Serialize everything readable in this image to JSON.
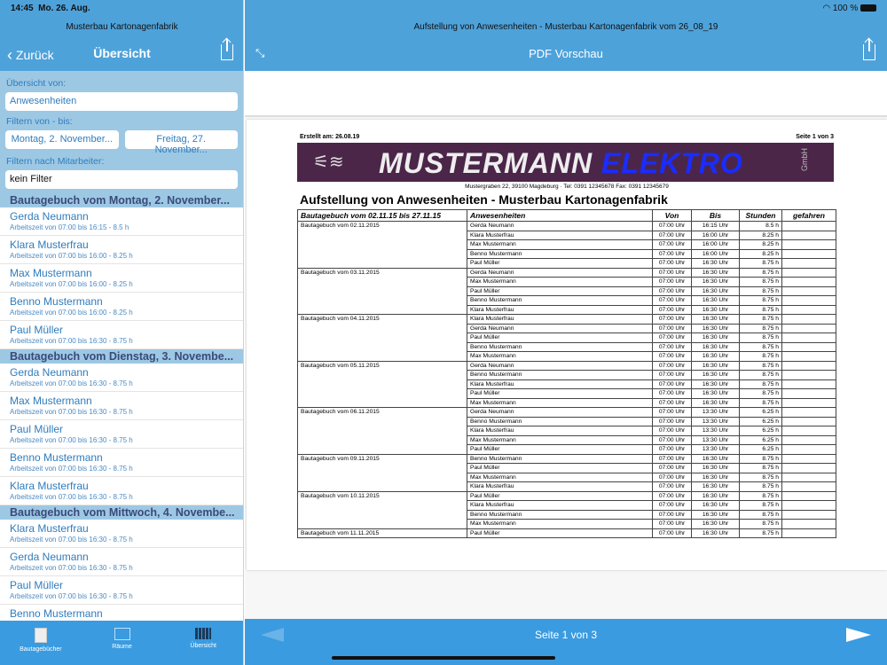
{
  "status": {
    "time": "14:45",
    "date": "Mo. 26. Aug.",
    "battery": "100 %"
  },
  "left": {
    "app_title": "Musterbau Kartonagenfabrik",
    "back": "Zurück",
    "title": "Übersicht",
    "overview_label": "Übersicht von:",
    "overview_value": "Anwesenheiten",
    "range_label": "Filtern von - bis:",
    "from": "Montag, 2. November...",
    "to": "Freitag, 27. November...",
    "employee_label": "Filtern nach Mitarbeiter:",
    "employee_value": "kein Filter",
    "sections": [
      {
        "title": "Bautagebuch vom Montag, 2. November...",
        "items": [
          {
            "name": "Gerda Neumann",
            "sub": "Arbeitszeit von 07:00 bis 16:15 - 8.5 h"
          },
          {
            "name": "Klara Musterfrau",
            "sub": "Arbeitszeit von 07:00 bis 16:00 - 8.25 h"
          },
          {
            "name": "Max Mustermann",
            "sub": "Arbeitszeit von 07:00 bis 16:00 - 8.25 h"
          },
          {
            "name": "Benno Mustermann",
            "sub": "Arbeitszeit von 07:00 bis 16:00 - 8.25 h"
          },
          {
            "name": "Paul Müller",
            "sub": "Arbeitszeit von 07:00 bis 16:30 - 8.75 h"
          }
        ]
      },
      {
        "title": "Bautagebuch vom Dienstag, 3. Novembe...",
        "items": [
          {
            "name": "Gerda Neumann",
            "sub": "Arbeitszeit von 07:00 bis 16:30 - 8.75 h"
          },
          {
            "name": "Max Mustermann",
            "sub": "Arbeitszeit von 07:00 bis 16:30 - 8.75 h"
          },
          {
            "name": "Paul Müller",
            "sub": "Arbeitszeit von 07:00 bis 16:30 - 8.75 h"
          },
          {
            "name": "Benno Mustermann",
            "sub": "Arbeitszeit von 07:00 bis 16:30 - 8.75 h"
          },
          {
            "name": "Klara Musterfrau",
            "sub": "Arbeitszeit von 07:00 bis 16:30 - 8.75 h"
          }
        ]
      },
      {
        "title": "Bautagebuch vom Mittwoch, 4. Novembe...",
        "items": [
          {
            "name": "Klara Musterfrau",
            "sub": "Arbeitszeit von 07:00 bis 16:30 - 8.75 h"
          },
          {
            "name": "Gerda Neumann",
            "sub": "Arbeitszeit von 07:00 bis 16:30 - 8.75 h"
          },
          {
            "name": "Paul Müller",
            "sub": "Arbeitszeit von 07:00 bis 16:30 - 8.75 h"
          },
          {
            "name": "Benno Mustermann",
            "sub": ""
          }
        ]
      }
    ],
    "tabs": [
      "Bautagebücher",
      "Räume",
      "Übersicht"
    ]
  },
  "right": {
    "doc_title": "Aufstellung von Anwesenheiten - Musterbau Kartonagenfabrik vom 26_08_19",
    "nav_title": "PDF Vorschau",
    "page_indicator": "Seite 1 von 3"
  },
  "pdf": {
    "created": "Erstellt am: 26.08.19",
    "page": "Seite 1 von  3",
    "logo_text_1": "MUSTERMANN",
    "logo_text_2": "ELEKTRO",
    "logo_gmbh": "GmbH",
    "address": "Mustergraben 22, 39100 Magdeburg  ·  Tel: 0391 12345678 Fax: 0391 12345679",
    "title": "Aufstellung von Anwesenheiten - Musterbau Kartonagenfabrik",
    "headers": [
      "Bautagebuch vom 02.11.15 bis 27.11.15",
      "Anwesenheiten",
      "Von",
      "Bis",
      "Stunden",
      "gefahren"
    ],
    "groups": [
      {
        "date": "Bautagebuch vom 02.11.2015",
        "rows": [
          [
            "Gerda Neumann",
            "07:00 Uhr",
            "16:15 Uhr",
            "8.5 h"
          ],
          [
            "Klara Musterfrau",
            "07:00 Uhr",
            "16:00 Uhr",
            "8.25 h"
          ],
          [
            "Max Mustermann",
            "07:00 Uhr",
            "16:00 Uhr",
            "8.25 h"
          ],
          [
            "Benno Mustermann",
            "07:00 Uhr",
            "16:00 Uhr",
            "8.25 h"
          ],
          [
            "Paul Müller",
            "07:00 Uhr",
            "16:30 Uhr",
            "8.75 h"
          ]
        ]
      },
      {
        "date": "Bautagebuch vom 03.11.2015",
        "rows": [
          [
            "Gerda Neumann",
            "07:00 Uhr",
            "16:30 Uhr",
            "8.75 h"
          ],
          [
            "Max Mustermann",
            "07:00 Uhr",
            "16:30 Uhr",
            "8.75 h"
          ],
          [
            "Paul Müller",
            "07:00 Uhr",
            "16:30 Uhr",
            "8.75 h"
          ],
          [
            "Benno Mustermann",
            "07:00 Uhr",
            "16:30 Uhr",
            "8.75 h"
          ],
          [
            "Klara Musterfrau",
            "07:00 Uhr",
            "16:30 Uhr",
            "8.75 h"
          ]
        ]
      },
      {
        "date": "Bautagebuch vom 04.11.2015",
        "rows": [
          [
            "Klara Musterfrau",
            "07:00 Uhr",
            "16:30 Uhr",
            "8.75 h"
          ],
          [
            "Gerda Neumann",
            "07:00 Uhr",
            "16:30 Uhr",
            "8.75 h"
          ],
          [
            "Paul Müller",
            "07:00 Uhr",
            "16:30 Uhr",
            "8.75 h"
          ],
          [
            "Benno Mustermann",
            "07:00 Uhr",
            "16:30 Uhr",
            "8.75 h"
          ],
          [
            "Max Mustermann",
            "07:00 Uhr",
            "16:30 Uhr",
            "8.75 h"
          ]
        ]
      },
      {
        "date": "Bautagebuch vom 05.11.2015",
        "rows": [
          [
            "Gerda Neumann",
            "07:00 Uhr",
            "16:30 Uhr",
            "8.75 h"
          ],
          [
            "Benno Mustermann",
            "07:00 Uhr",
            "16:30 Uhr",
            "8.75 h"
          ],
          [
            "Klara Musterfrau",
            "07:00 Uhr",
            "16:30 Uhr",
            "8.75 h"
          ],
          [
            "Paul Müller",
            "07:00 Uhr",
            "16:30 Uhr",
            "8.75 h"
          ],
          [
            "Max Mustermann",
            "07:00 Uhr",
            "16:30 Uhr",
            "8.75 h"
          ]
        ]
      },
      {
        "date": "Bautagebuch vom 06.11.2015",
        "rows": [
          [
            "Gerda Neumann",
            "07:00 Uhr",
            "13:30 Uhr",
            "6.25 h"
          ],
          [
            "Benno Mustermann",
            "07:00 Uhr",
            "13:30 Uhr",
            "6.25 h"
          ],
          [
            "Klara Musterfrau",
            "07:00 Uhr",
            "13:30 Uhr",
            "6.25 h"
          ],
          [
            "Max Mustermann",
            "07:00 Uhr",
            "13:30 Uhr",
            "6.25 h"
          ],
          [
            "Paul Müller",
            "07:00 Uhr",
            "13:30 Uhr",
            "6.25 h"
          ]
        ]
      },
      {
        "date": "Bautagebuch vom 09.11.2015",
        "rows": [
          [
            "Benno Mustermann",
            "07:00 Uhr",
            "16:30 Uhr",
            "8.75 h"
          ],
          [
            "Paul Müller",
            "07:00 Uhr",
            "16:30 Uhr",
            "8.75 h"
          ],
          [
            "Max Mustermann",
            "07:00 Uhr",
            "16:30 Uhr",
            "8.75 h"
          ],
          [
            "Klara Musterfrau",
            "07:00 Uhr",
            "16:30 Uhr",
            "8.75 h"
          ]
        ]
      },
      {
        "date": "Bautagebuch vom 10.11.2015",
        "rows": [
          [
            "Paul Müller",
            "07:00 Uhr",
            "16:30 Uhr",
            "8.75 h"
          ],
          [
            "Klara Musterfrau",
            "07:00 Uhr",
            "16:30 Uhr",
            "8.75 h"
          ],
          [
            "Benno Mustermann",
            "07:00 Uhr",
            "16:30 Uhr",
            "8.75 h"
          ],
          [
            "Max Mustermann",
            "07:00 Uhr",
            "16:30 Uhr",
            "8.75 h"
          ]
        ]
      },
      {
        "date": "Bautagebuch vom 11.11.2015",
        "rows": [
          [
            "Paul Müller",
            "07:00 Uhr",
            "16:30 Uhr",
            "8.75 h"
          ]
        ]
      }
    ]
  }
}
